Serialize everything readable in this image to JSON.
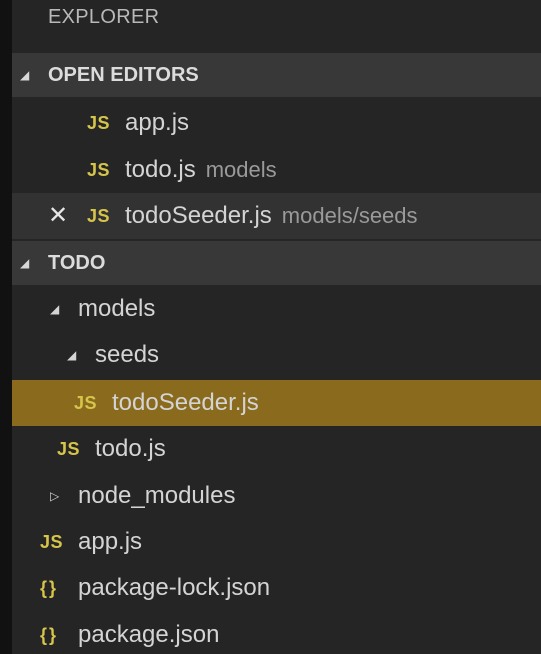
{
  "explorer": {
    "title": "EXPLORER"
  },
  "open_editors": {
    "header": "OPEN EDITORS",
    "items": [
      {
        "icon": "JS",
        "name": "app.js",
        "description": ""
      },
      {
        "icon": "JS",
        "name": "todo.js",
        "description": "models"
      },
      {
        "icon": "JS",
        "name": "todoSeeder.js",
        "description": "models/seeds",
        "close": "✕"
      }
    ]
  },
  "workspace": {
    "header": "TODO",
    "tree": [
      {
        "type": "folder",
        "name": "models",
        "expanded": true
      },
      {
        "type": "folder",
        "name": "seeds",
        "expanded": true
      },
      {
        "type": "file",
        "icon": "JS",
        "name": "todoSeeder.js",
        "selected": true
      },
      {
        "type": "file",
        "icon": "JS",
        "name": "todo.js"
      },
      {
        "type": "folder",
        "name": "node_modules",
        "expanded": false
      },
      {
        "type": "file",
        "icon": "JS",
        "name": "app.js"
      },
      {
        "type": "file",
        "icon": "{}",
        "name": "package-lock.json"
      },
      {
        "type": "file",
        "icon": "{}",
        "name": "package.json"
      }
    ]
  },
  "icons": {
    "expanded": "chevron-down-icon",
    "collapsed": "chevron-right-icon",
    "js": "js-file-icon",
    "json": "json-file-icon",
    "close": "close-icon"
  },
  "colors": {
    "sidebar_background": "#252526",
    "section_header_background": "#383838",
    "selected_row_background": "#8a6a1d",
    "js_icon": "#d7c44a",
    "text": "#d4d4d4",
    "description_text": "#9a9a9a"
  }
}
